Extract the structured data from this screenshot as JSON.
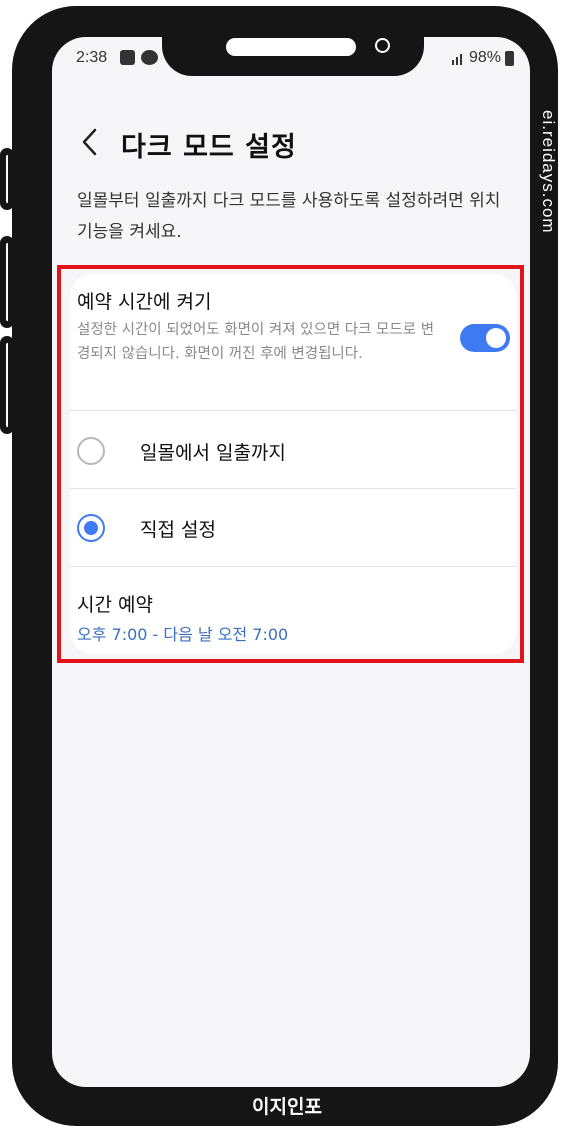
{
  "status_bar": {
    "time": "2:38",
    "battery": "98%",
    "icons": [
      "gallery-icon",
      "talk-icon",
      "hd-icon",
      "signal-icon",
      "battery-icon"
    ]
  },
  "header": {
    "back_icon": "chevron-left-icon",
    "title": "다크 모드 설정"
  },
  "description": "일몰부터 일출까지 다크 모드를 사용하도록 설정하려면 위치 기능을 켜세요.",
  "schedule": {
    "title": "예약 시간에 켜기",
    "subtitle": "설정한 시간이 되었어도 화면이 켜져 있으면 다크 모드로 변경되지 않습니다. 화면이 꺼진 후에 변경됩니다.",
    "enabled": true
  },
  "options": [
    {
      "label": "일몰에서 일출까지",
      "selected": false
    },
    {
      "label": "직접 설정",
      "selected": true
    }
  ],
  "time_schedule": {
    "title": "시간 예약",
    "value": "오후 7:00 - 다음 날 오전 7:00"
  },
  "watermark": "ei.reidays.com",
  "brand": "이지인포",
  "colors": {
    "accent": "#3e7bf2",
    "highlight": "#e3131c",
    "link": "#3a6fbf"
  }
}
